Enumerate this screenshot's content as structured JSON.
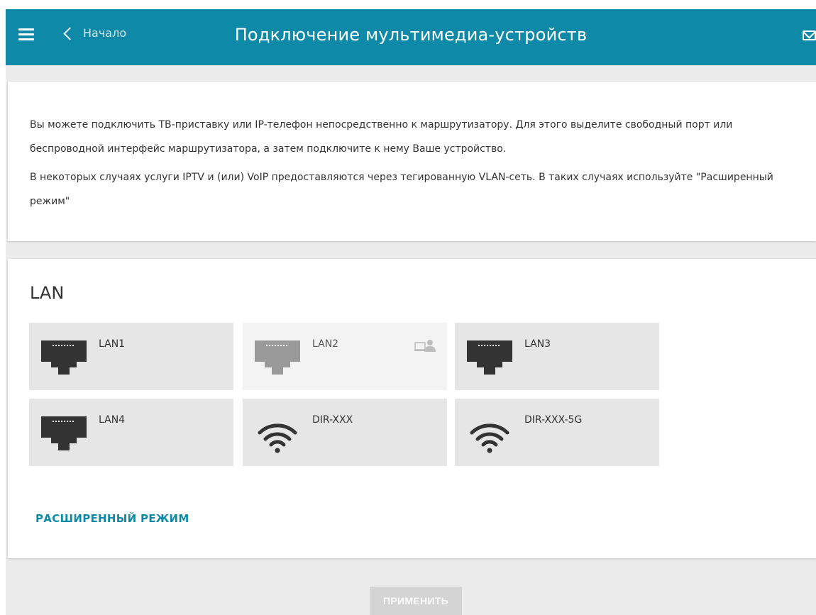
{
  "header": {
    "back_label": "Начало",
    "title": "Подключение мультимедиа-устройств",
    "menu_icon": "hamburger-icon",
    "back_icon": "chevron-left-icon",
    "mail_icon": "mail-icon",
    "background_color": "#0e8aa8"
  },
  "info": {
    "paragraph1": "Вы можете подключить ТВ-приставку или IP-телефон непосредственно к маршрутизатору. Для этого выделите свободный порт или беспроводной интерфейс маршрутизатора, а затем подключите к нему Ваше устройство.",
    "paragraph2": "В некоторых случаях услуги IPTV и (или) VoIP предоставляются через тегированную VLAN-сеть. В таких случаях используйте \"Расширенный режим\""
  },
  "lan": {
    "title": "LAN",
    "tiles": [
      {
        "label": "LAN1",
        "icon": "ethernet-port-icon",
        "state": "available"
      },
      {
        "label": "LAN2",
        "icon": "ethernet-port-icon",
        "state": "assigned"
      },
      {
        "label": "LAN3",
        "icon": "ethernet-port-icon",
        "state": "available"
      },
      {
        "label": "LAN4",
        "icon": "ethernet-port-icon",
        "state": "available"
      },
      {
        "label": "DIR-XXX",
        "icon": "wifi-icon",
        "state": "available"
      },
      {
        "label": "DIR-XXX-5G",
        "icon": "wifi-icon",
        "state": "available"
      }
    ],
    "advanced_mode_label": "РАСШИРЕННЫЙ РЕЖИМ"
  },
  "footer": {
    "apply_label": "ПРИМЕНИТЬ"
  },
  "colors": {
    "accent": "#0e8aa8",
    "tile_background": "#e6e6e6",
    "tile_disabled_background": "#f3f3f3",
    "apply_button_disabled": "#d4d4d4"
  }
}
